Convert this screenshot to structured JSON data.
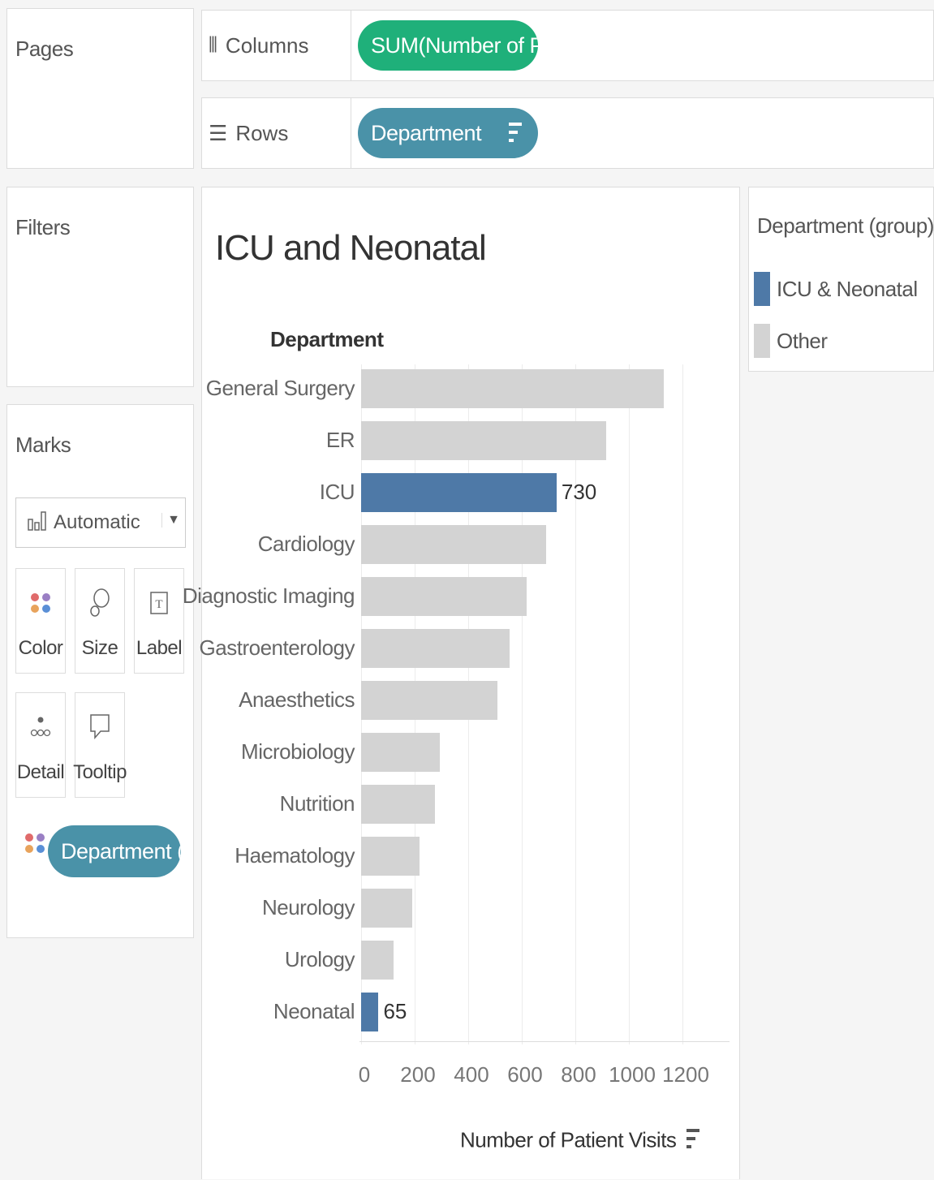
{
  "pages": {
    "title": "Pages"
  },
  "columns_shelf": {
    "label": "Columns",
    "pill": "SUM(Number of Pati.."
  },
  "rows_shelf": {
    "label": "Rows",
    "pill": "Department"
  },
  "filters": {
    "title": "Filters"
  },
  "marks": {
    "title": "Marks",
    "mark_type": "Automatic",
    "buttons": {
      "color": "Color",
      "size": "Size",
      "label": "Label",
      "detail": "Detail",
      "tooltip": "Tooltip"
    },
    "color_pill": "Department (g.."
  },
  "legend": {
    "title": "Department (group)",
    "items": [
      {
        "label": "ICU & Neonatal",
        "color": "#4e79a7"
      },
      {
        "label": "Other",
        "color": "#d3d3d3"
      }
    ]
  },
  "colors": {
    "highlight": "#4e79a7",
    "other": "#d3d3d3"
  },
  "chart_data": {
    "type": "bar",
    "title": "ICU and Neonatal",
    "row_header": "Department",
    "xlabel": "Number of Patient Visits",
    "categories": [
      "General Surgery",
      "ER",
      "ICU",
      "Cardiology",
      "Diagnostic Imaging",
      "Gastroenterology",
      "Anaesthetics",
      "Microbiology",
      "Nutrition",
      "Haematology",
      "Neurology",
      "Urology",
      "Neonatal"
    ],
    "values": [
      1130,
      915,
      730,
      690,
      618,
      555,
      510,
      295,
      277,
      218,
      192,
      120,
      65
    ],
    "groups": [
      "Other",
      "Other",
      "ICU & Neonatal",
      "Other",
      "Other",
      "Other",
      "Other",
      "Other",
      "Other",
      "Other",
      "Other",
      "Other",
      "ICU & Neonatal"
    ],
    "data_labels": {
      "ICU": "730",
      "Neonatal": "65"
    },
    "xticks": [
      "0",
      "200",
      "400",
      "600",
      "800",
      "1000",
      "1200"
    ],
    "xlim": [
      0,
      1380
    ]
  }
}
